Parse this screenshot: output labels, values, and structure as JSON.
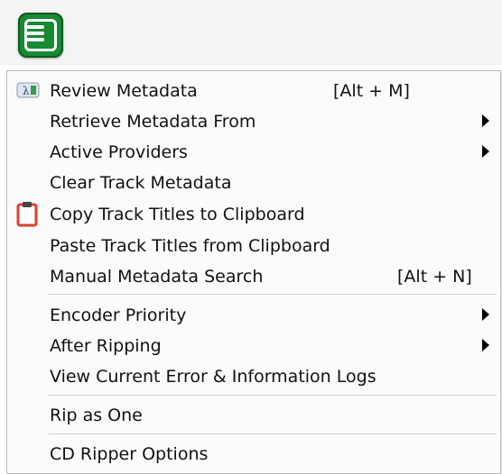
{
  "toolbar": {
    "menu_icon": "menu-list-icon",
    "accent": "#178a33"
  },
  "menu": {
    "items": [
      {
        "label": "Review Metadata",
        "shortcut": "[Alt + M]",
        "icon": "metadata-icon"
      },
      {
        "label": "Retrieve Metadata From",
        "submenu": true
      },
      {
        "label": "Active Providers",
        "submenu": true
      },
      {
        "label": "Clear Track Metadata"
      },
      {
        "label": "Copy Track Titles to Clipboard",
        "icon": "clipboard-icon"
      },
      {
        "label": "Paste Track Titles from Clipboard"
      },
      {
        "label": "Manual Metadata Search",
        "shortcut": "[Alt + N]"
      },
      {
        "label": "Encoder Priority",
        "submenu": true
      },
      {
        "label": "After Ripping",
        "submenu": true
      },
      {
        "label": "View Current Error & Information Logs"
      },
      {
        "label": "Rip as One"
      },
      {
        "label": "CD Ripper Options"
      }
    ]
  }
}
